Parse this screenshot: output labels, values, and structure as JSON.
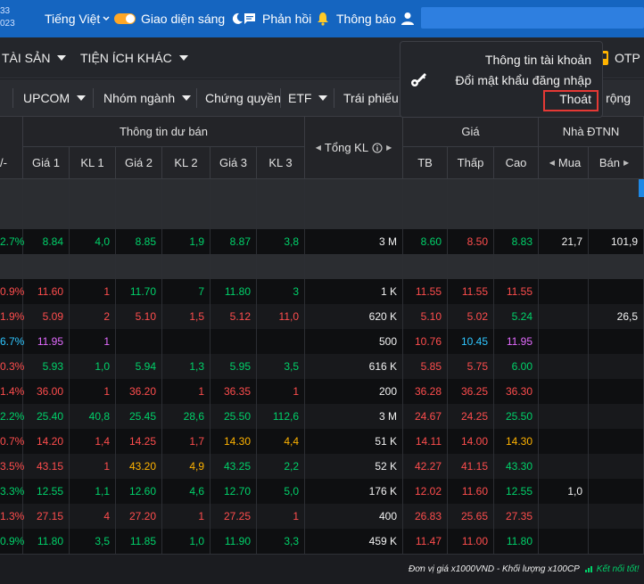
{
  "topbar": {
    "clock": [
      "33",
      "023"
    ],
    "language": "Tiếng Việt",
    "theme": "Giao diện sáng",
    "feedback": "Phản hồi",
    "notify": "Thông báo"
  },
  "menubar": {
    "items": [
      "TÀI SẢN",
      "TIỆN ÍCH KHÁC"
    ],
    "otp": "OTP"
  },
  "tabs": [
    "UPCOM",
    "Nhóm ngành",
    "Chứng quyền",
    "ETF",
    "Trái phiếu",
    "ở rộng"
  ],
  "account_menu": {
    "info": "Thông tin tài khoản",
    "change_password": "Đổi mật khẩu đăng nhập",
    "logout": "Thoát"
  },
  "header": {
    "buy_group": "Thông tin dư bán",
    "total_vol": "Tổng KL",
    "price_group": "Giá",
    "foreign_group": "Nhà ĐTNN",
    "cols": {
      "change": "/-",
      "g1": "Giá 1",
      "kl1": "KL 1",
      "g2": "Giá 2",
      "kl2": "KL 2",
      "g3": "Giá 3",
      "kl3": "KL 3",
      "tb": "TB",
      "low": "Thấp",
      "high": "Cao",
      "buy": "Mua",
      "sell": "Bán"
    }
  },
  "rows": [
    {
      "type": "blank"
    },
    {
      "type": "blank"
    },
    {
      "type": "data",
      "chg": "2.7%",
      "g1": "8.84",
      "kl1": "4,0",
      "g2": "8.85",
      "kl2": "1,9",
      "g3": "8.87",
      "kl3": "3,8",
      "tkl": "3 M",
      "tb": "8.60",
      "low": "8.50",
      "high": "8.83",
      "buy": "21,7",
      "sell": "101,9",
      "c": {
        "chg": "green",
        "g1": "green",
        "kl1": "green",
        "g2": "green",
        "kl2": "green",
        "g3": "green",
        "kl3": "green",
        "tb": "green",
        "low": "red",
        "high": "green"
      }
    },
    {
      "type": "blank"
    },
    {
      "type": "data",
      "chg": "0.9%",
      "g1": "11.60",
      "kl1": "1",
      "g2": "11.70",
      "kl2": "7",
      "g3": "11.80",
      "kl3": "3",
      "tkl": "1 K",
      "tb": "11.55",
      "low": "11.55",
      "high": "11.55",
      "buy": "",
      "sell": "",
      "c": {
        "chg": "red",
        "g1": "red",
        "kl1": "red",
        "g2": "green",
        "kl2": "green",
        "g3": "green",
        "kl3": "green",
        "tb": "red",
        "low": "red",
        "high": "red"
      }
    },
    {
      "type": "data",
      "chg": "1.9%",
      "g1": "5.09",
      "kl1": "2",
      "g2": "5.10",
      "kl2": "1,5",
      "g3": "5.12",
      "kl3": "11,0",
      "tkl": "620 K",
      "tb": "5.10",
      "low": "5.02",
      "high": "5.24",
      "buy": "",
      "sell": "26,5",
      "c": {
        "chg": "red",
        "g1": "red",
        "kl1": "red",
        "g2": "red",
        "kl2": "red",
        "g3": "red",
        "kl3": "red",
        "tb": "red",
        "low": "red",
        "high": "green"
      }
    },
    {
      "type": "data",
      "chg": "6.7%",
      "g1": "11.95",
      "kl1": "1",
      "g2": "",
      "kl2": "",
      "g3": "",
      "kl3": "",
      "tkl": "500",
      "tb": "10.76",
      "low": "10.45",
      "high": "11.95",
      "buy": "",
      "sell": "",
      "c": {
        "chg": "cyan",
        "g1": "purple",
        "kl1": "purple",
        "tb": "red",
        "low": "cyan",
        "high": "purple"
      }
    },
    {
      "type": "data",
      "chg": "0.3%",
      "g1": "5.93",
      "kl1": "1,0",
      "g2": "5.94",
      "kl2": "1,3",
      "g3": "5.95",
      "kl3": "3,5",
      "tkl": "616 K",
      "tb": "5.85",
      "low": "5.75",
      "high": "6.00",
      "buy": "",
      "sell": "",
      "c": {
        "chg": "red",
        "g1": "green",
        "kl1": "green",
        "g2": "green",
        "kl2": "green",
        "g3": "green",
        "kl3": "green",
        "tb": "red",
        "low": "red",
        "high": "green"
      }
    },
    {
      "type": "data",
      "chg": "1.4%",
      "g1": "36.00",
      "kl1": "1",
      "g2": "36.20",
      "kl2": "1",
      "g3": "36.35",
      "kl3": "1",
      "tkl": "200",
      "tb": "36.28",
      "low": "36.25",
      "high": "36.30",
      "buy": "",
      "sell": "",
      "c": {
        "chg": "red",
        "g1": "red",
        "kl1": "red",
        "g2": "red",
        "kl2": "red",
        "g3": "red",
        "kl3": "red",
        "tb": "red",
        "low": "red",
        "high": "red"
      }
    },
    {
      "type": "data",
      "chg": "2.2%",
      "g1": "25.40",
      "kl1": "40,8",
      "g2": "25.45",
      "kl2": "28,6",
      "g3": "25.50",
      "kl3": "112,6",
      "tkl": "3 M",
      "tb": "24.67",
      "low": "24.25",
      "high": "25.50",
      "buy": "",
      "sell": "",
      "c": {
        "chg": "green",
        "g1": "green",
        "kl1": "green",
        "g2": "green",
        "kl2": "green",
        "g3": "green",
        "kl3": "green",
        "tb": "red",
        "low": "red",
        "high": "green"
      }
    },
    {
      "type": "data",
      "chg": "0.7%",
      "g1": "14.20",
      "kl1": "1,4",
      "g2": "14.25",
      "kl2": "1,7",
      "g3": "14.30",
      "kl3": "4,4",
      "tkl": "51 K",
      "tb": "14.11",
      "low": "14.00",
      "high": "14.30",
      "buy": "",
      "sell": "",
      "c": {
        "chg": "red",
        "g1": "red",
        "kl1": "red",
        "g2": "red",
        "kl2": "red",
        "g3": "yellow",
        "kl3": "yellow",
        "tb": "red",
        "low": "red",
        "high": "yellow"
      }
    },
    {
      "type": "data",
      "chg": "3.5%",
      "g1": "43.15",
      "kl1": "1",
      "g2": "43.20",
      "kl2": "4,9",
      "g3": "43.25",
      "kl3": "2,2",
      "tkl": "52 K",
      "tb": "42.27",
      "low": "41.15",
      "high": "43.30",
      "buy": "",
      "sell": "",
      "c": {
        "chg": "red",
        "g1": "red",
        "kl1": "red",
        "g2": "yellow",
        "kl2": "yellow",
        "g3": "green",
        "kl3": "green",
        "tb": "red",
        "low": "red",
        "high": "green"
      }
    },
    {
      "type": "data",
      "chg": "3.3%",
      "g1": "12.55",
      "kl1": "1,1",
      "g2": "12.60",
      "kl2": "4,6",
      "g3": "12.70",
      "kl3": "5,0",
      "tkl": "176 K",
      "tb": "12.02",
      "low": "11.60",
      "high": "12.55",
      "buy": "1,0",
      "sell": "",
      "c": {
        "chg": "green",
        "g1": "green",
        "kl1": "green",
        "g2": "green",
        "kl2": "green",
        "g3": "green",
        "kl3": "green",
        "tb": "red",
        "low": "red",
        "high": "green"
      }
    },
    {
      "type": "data",
      "chg": "1.3%",
      "g1": "27.15",
      "kl1": "4",
      "g2": "27.20",
      "kl2": "1",
      "g3": "27.25",
      "kl3": "1",
      "tkl": "400",
      "tb": "26.83",
      "low": "25.65",
      "high": "27.35",
      "buy": "",
      "sell": "",
      "c": {
        "chg": "red",
        "g1": "red",
        "kl1": "red",
        "g2": "red",
        "kl2": "red",
        "g3": "red",
        "kl3": "red",
        "tb": "red",
        "low": "red",
        "high": "red"
      }
    },
    {
      "type": "data",
      "chg": "0.9%",
      "g1": "11.80",
      "kl1": "3,5",
      "g2": "11.85",
      "kl2": "1,0",
      "g3": "11.90",
      "kl3": "3,3",
      "tkl": "459 K",
      "tb": "11.47",
      "low": "11.00",
      "high": "11.80",
      "buy": "",
      "sell": "",
      "c": {
        "chg": "green",
        "g1": "green",
        "kl1": "green",
        "g2": "green",
        "kl2": "green",
        "g3": "green",
        "kl3": "green",
        "tb": "red",
        "low": "red",
        "high": "green"
      }
    }
  ],
  "footer": {
    "unit": "Đơn vị giá x1000VND - Khối lượng x100CP",
    "connection": "Kết nối tốt!"
  },
  "colors": {
    "topbar": "#1565c0",
    "green": "#00d26a",
    "red": "#ff4d4d",
    "yellow": "#ffb300",
    "purple": "#e36bff",
    "cyan": "#2fc6ff",
    "highlight_box": "#e53935"
  },
  "icons": [
    "chevron-down-icon",
    "moon-icon",
    "chat-icon",
    "bell-icon",
    "user-icon",
    "key-icon",
    "otp-icon",
    "info-icon"
  ]
}
